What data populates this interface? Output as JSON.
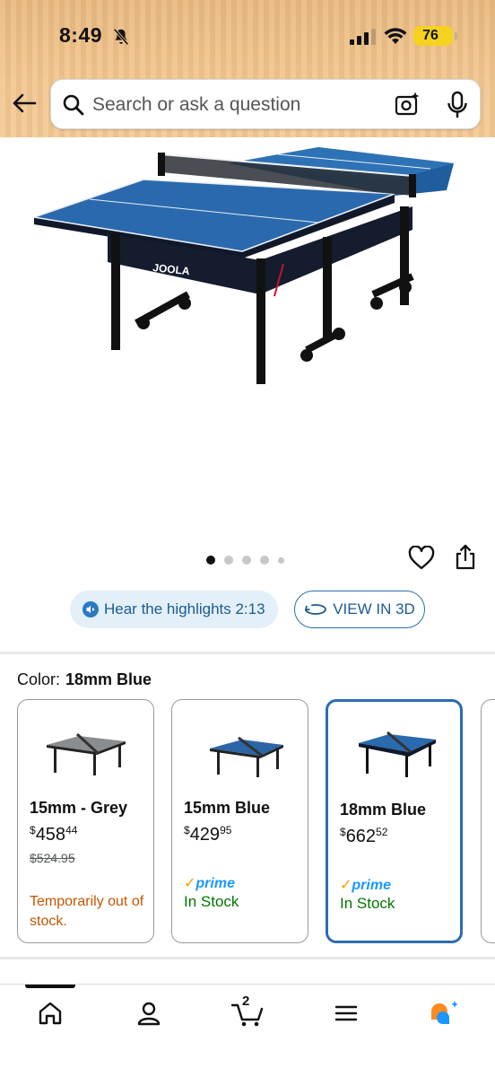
{
  "status_bar": {
    "time": "8:49",
    "battery": "76"
  },
  "search": {
    "placeholder": "Search or ask a question"
  },
  "product": {
    "image_alt": "JOOLA table tennis table",
    "brand_marks": [
      "JOOLA",
      "JOOLA",
      "JOOLA"
    ],
    "carousel_dots": 5,
    "carousel_active": 0
  },
  "actions": {
    "highlights_label": "Hear the highlights 2:13",
    "view3d_label": "VIEW IN 3D"
  },
  "color": {
    "label": "Color:",
    "selected": "18mm Blue"
  },
  "swatches": [
    {
      "name": "15mm - Grey",
      "price_symbol": "$",
      "price_whole": "458",
      "price_cents": "44",
      "old_price": "$524.95",
      "availability": "Temporarily out of stock."
    },
    {
      "name": "15mm Blue",
      "price_symbol": "$",
      "price_whole": "429",
      "price_cents": "95",
      "prime": "prime",
      "availability": "In Stock"
    },
    {
      "name": "18mm Blue",
      "price_symbol": "$",
      "price_whole": "662",
      "price_cents": "52",
      "prime": "prime",
      "availability": "In Stock"
    }
  ],
  "bottom_nav": {
    "cart_count": "2",
    "items": [
      "home-icon",
      "account-icon",
      "cart-icon",
      "menu-icon",
      "rufus-icon"
    ]
  },
  "colors": {
    "header_bg": "#f2c68f",
    "link_blue": "#1c5b90",
    "selected_border": "#2b6cb0",
    "in_stock": "#007600",
    "out_of_stock": "#c45500",
    "prime_blue": "#1a98ff"
  }
}
